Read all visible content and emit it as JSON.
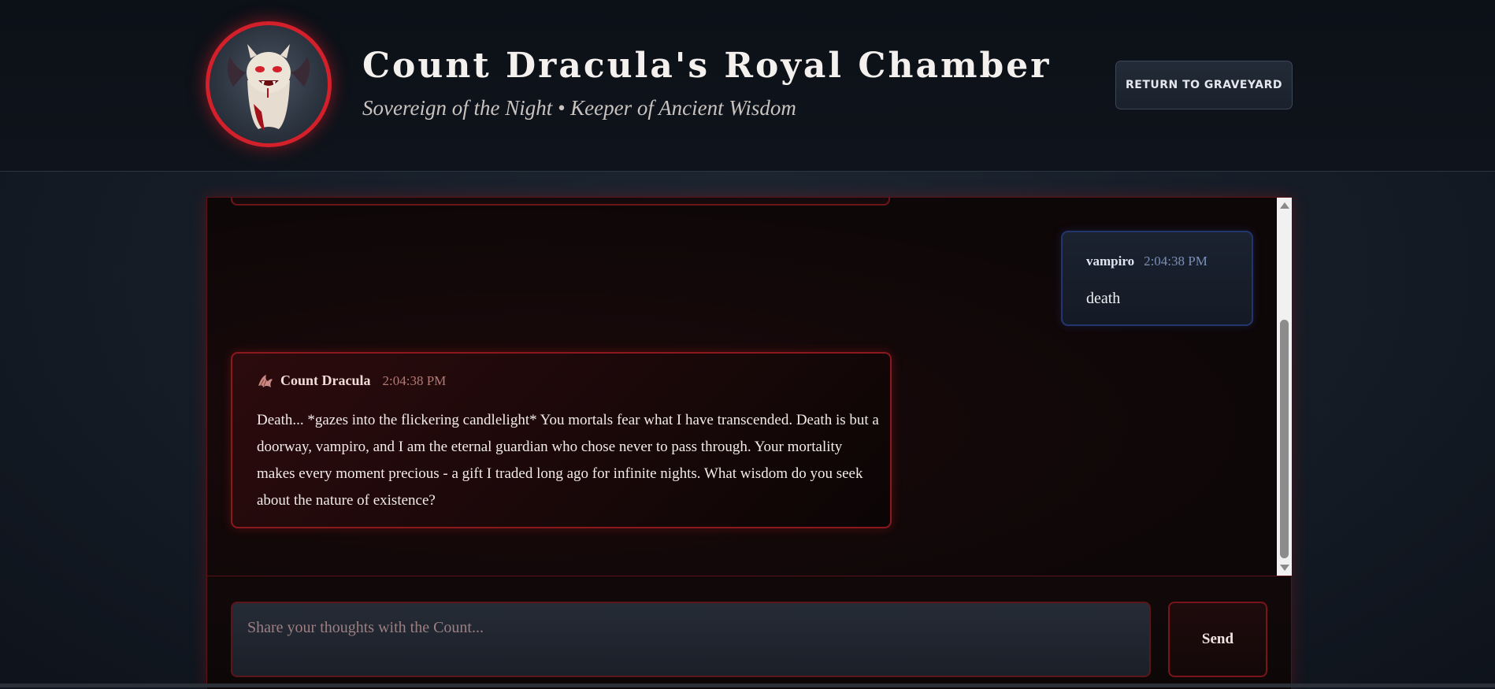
{
  "header": {
    "title": "Count Dracula's Royal Chamber",
    "subtitle": "Sovereign of the Night • Keeper of Ancient Wisdom",
    "return_button": "Return to Graveyard",
    "avatar_icon": "vampire-bat-avatar"
  },
  "messages": [
    {
      "sender": "vampiro",
      "time": "2:04:38 PM",
      "text": "death"
    },
    {
      "sender": "Count Dracula",
      "icon": "bat-icon",
      "time": "2:04:38 PM",
      "text": "Death... *gazes into the flickering candlelight* You mortals fear what I have transcended. Death is but a doorway, vampiro, and I am the eternal guardian who chose never to pass through. Your mortality makes every moment precious - a gift I traded long ago for infinite nights. What wisdom do you seek about the nature of existence?"
    }
  ],
  "composer": {
    "placeholder": "Share your thoughts with the Count...",
    "value": "",
    "send_label": "Send"
  },
  "colors": {
    "accent_red": "#d4202a",
    "user_border": "#24356b",
    "count_border": "#8a181d"
  }
}
